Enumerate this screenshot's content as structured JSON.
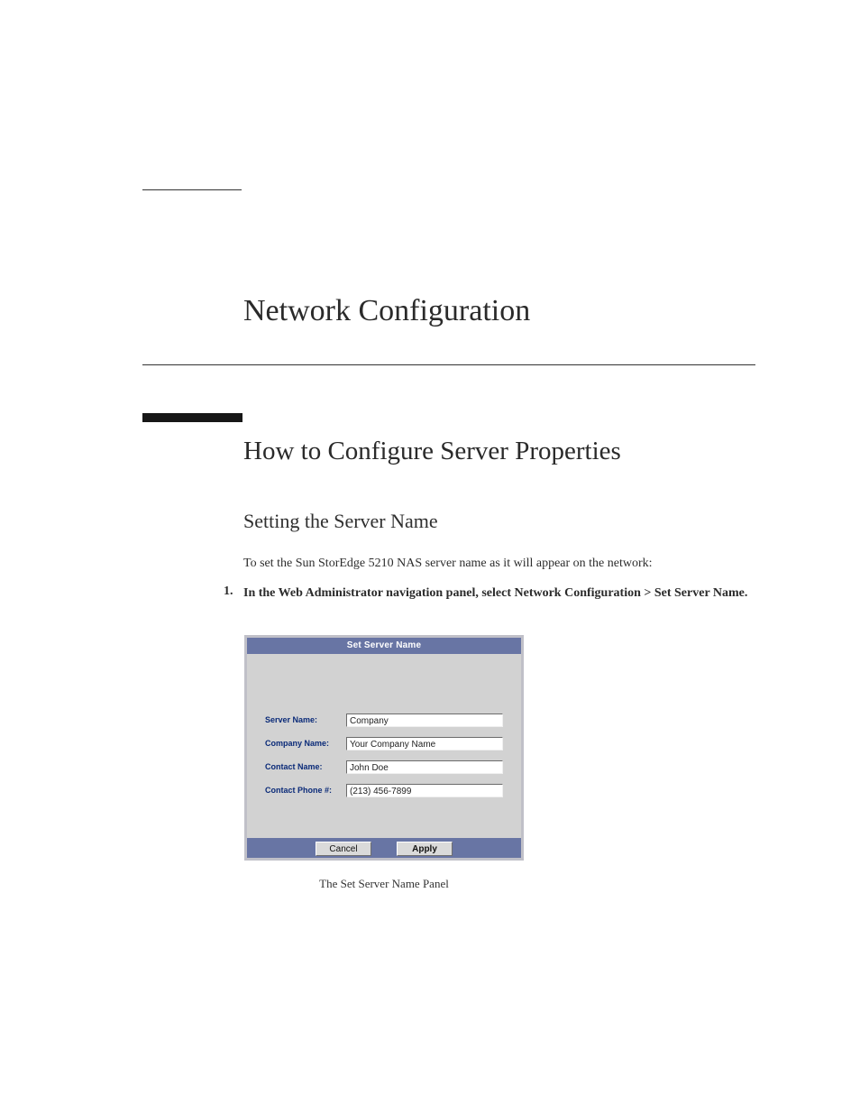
{
  "chapter_title": "Network Configuration",
  "h1": "How to Configure Server Properties",
  "h2": "Setting the Server Name",
  "intro_paragraph": "To set the Sun StorEdge 5210 NAS server name as it will appear on the network:",
  "step1_num": "1.",
  "step1_text": "In the Web Administrator navigation panel, select Network Configuration > Set Server Name.",
  "panel": {
    "title": "Set Server Name",
    "fields": {
      "server_name": {
        "label": "Server Name:",
        "value": "Company"
      },
      "company_name": {
        "label": "Company Name:",
        "value": "Your Company Name"
      },
      "contact_name": {
        "label": "Contact Name:",
        "value": "John Doe"
      },
      "contact_phone": {
        "label": "Contact Phone #:",
        "value": "(213) 456-7899"
      }
    },
    "buttons": {
      "cancel": "Cancel",
      "apply": "Apply"
    }
  },
  "caption": "The Set Server Name Panel"
}
